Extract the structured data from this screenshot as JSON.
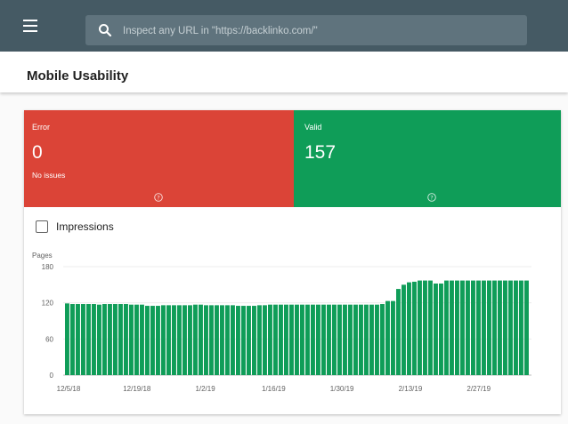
{
  "topbar": {
    "menu_icon": "menu-icon",
    "search_icon": "search-icon",
    "search_placeholder": "Inspect any URL in \"https://backlinko.com/\""
  },
  "page": {
    "title": "Mobile Usability"
  },
  "tiles": {
    "error": {
      "label": "Error",
      "value": "0",
      "sub": "No issues",
      "color": "#db4437"
    },
    "valid": {
      "label": "Valid",
      "value": "157",
      "color": "#0f9d58"
    }
  },
  "filter": {
    "impressions_label": "Impressions",
    "checked": false
  },
  "chart_data": {
    "type": "bar",
    "ylabel": "Pages",
    "ylim": [
      0,
      180
    ],
    "yticks": [
      0,
      60,
      120,
      180
    ],
    "color": "#0f9d58",
    "xtick_labels": [
      "12/5/18",
      "12/19/18",
      "1/2/19",
      "1/16/19",
      "1/30/19",
      "2/13/19",
      "2/27/19"
    ],
    "values": [
      119,
      118,
      118,
      118,
      118,
      118,
      117,
      118,
      118,
      118,
      118,
      118,
      117,
      117,
      117,
      115,
      115,
      115,
      116,
      116,
      116,
      116,
      116,
      116,
      117,
      117,
      116,
      116,
      116,
      116,
      116,
      116,
      115,
      115,
      115,
      115,
      116,
      116,
      117,
      117,
      117,
      117,
      117,
      117,
      117,
      117,
      117,
      117,
      117,
      117,
      117,
      117,
      117,
      117,
      117,
      117,
      117,
      117,
      117,
      118,
      123,
      123,
      143,
      150,
      154,
      155,
      157,
      157,
      157,
      152,
      152,
      157,
      157,
      157,
      157,
      157,
      157,
      157,
      157,
      157,
      157,
      157,
      157,
      157,
      157,
      157,
      157
    ]
  }
}
